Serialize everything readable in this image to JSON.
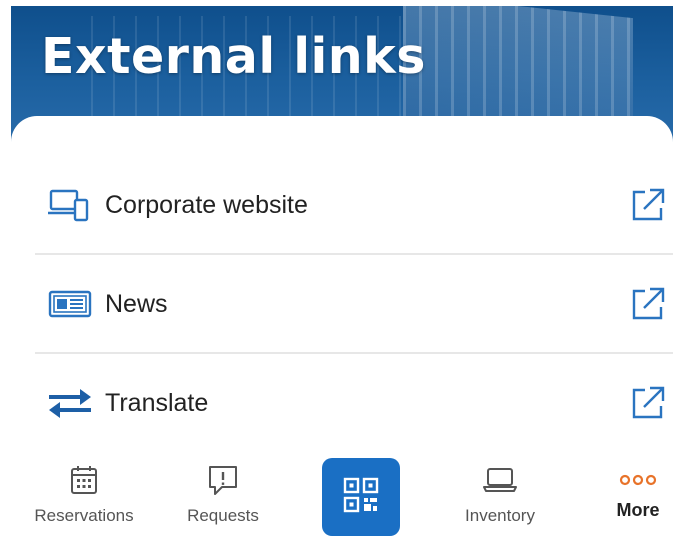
{
  "header": {
    "title": "External links"
  },
  "links": [
    {
      "label": "Corporate website",
      "icon": "devices-icon"
    },
    {
      "label": "News",
      "icon": "newspaper-icon"
    },
    {
      "label": "Translate",
      "icon": "swap-arrows-icon"
    }
  ],
  "external_icon": "open-external-icon",
  "bottom_nav": {
    "reservations": "Reservations",
    "requests": "Requests",
    "scan": "qr-code-icon",
    "inventory": "Inventory",
    "more": "More"
  },
  "colors": {
    "accent": "#1a6fc4",
    "icon_blue": "#2a74c0",
    "more_orange": "#e8732a"
  }
}
